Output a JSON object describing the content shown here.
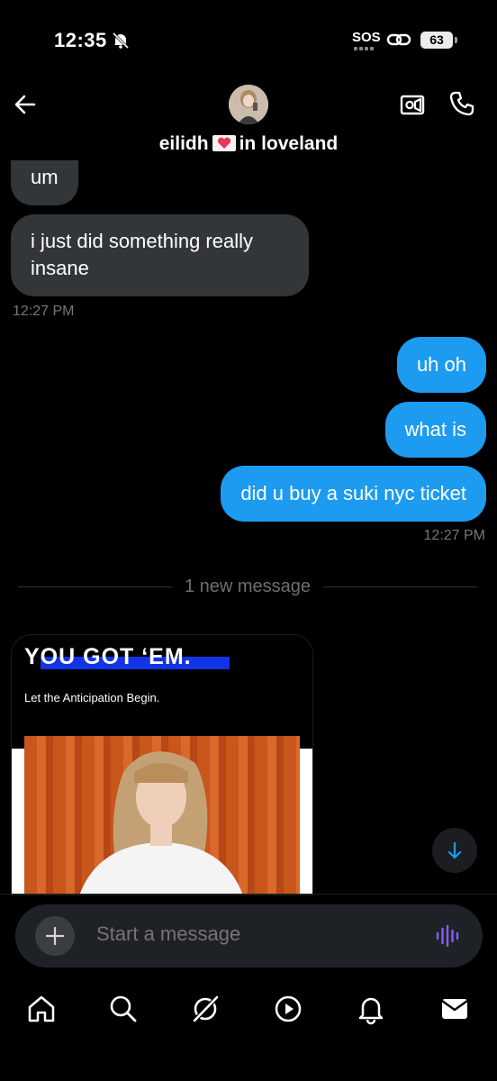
{
  "status_bar": {
    "time": "12:35",
    "sos": "SOS",
    "battery": "63"
  },
  "header": {
    "contact_name_first": "eilidh",
    "contact_name_rest": "in loveland"
  },
  "messages": [
    {
      "direction": "in",
      "text": "um"
    },
    {
      "direction": "in",
      "text": "i just did something really insane"
    },
    {
      "direction": "out",
      "text": "uh oh"
    },
    {
      "direction": "out",
      "text": "what is"
    },
    {
      "direction": "out",
      "text": "did u buy a suki nyc ticket"
    }
  ],
  "timestamps": {
    "incoming": "12:27 PM",
    "outgoing": "12:27 PM"
  },
  "divider_label": "1 new message",
  "media_card": {
    "title": "YOU GOT ‘EM.",
    "subtitle": "Let the Anticipation Begin."
  },
  "composer": {
    "placeholder": "Start a message"
  },
  "colors": {
    "outgoing_bubble": "#1d9bf0",
    "incoming_bubble": "#333639",
    "voice_accent": "#8b5cf6"
  },
  "nav_icons": [
    "home-icon",
    "search-icon",
    "grok-icon",
    "video-icon",
    "notifications-icon",
    "messages-icon"
  ]
}
